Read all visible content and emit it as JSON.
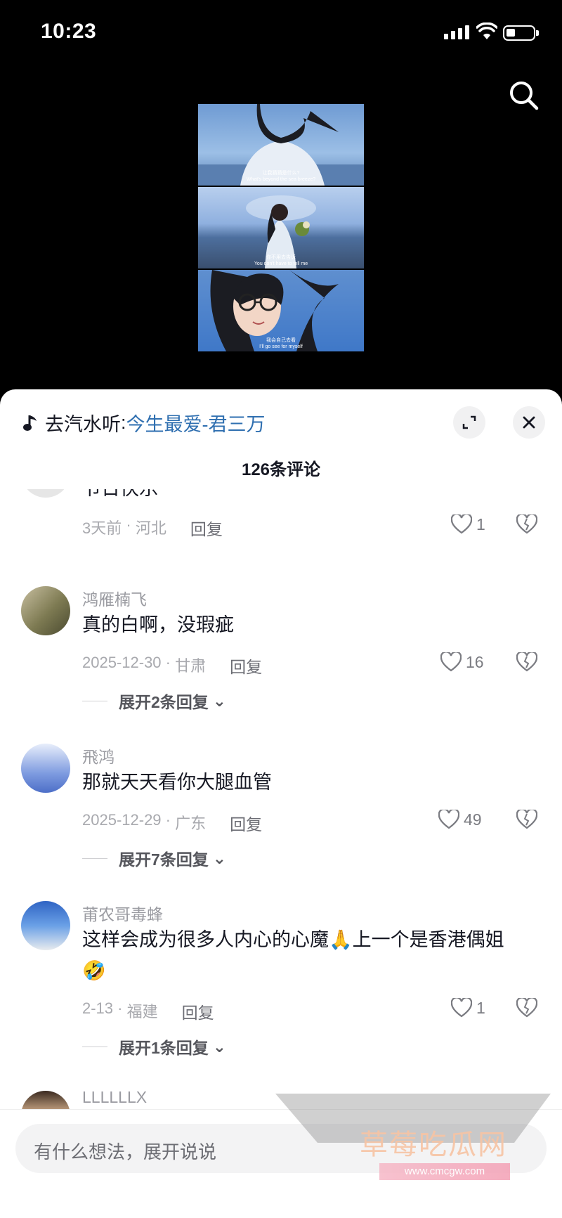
{
  "status": {
    "time": "10:23"
  },
  "music": {
    "prefix": "去汽水听",
    "separator": ":",
    "song": "今生最爱-君三万"
  },
  "comment_count": "126条评论",
  "video": {
    "subtitles": [
      {
        "cn": "让我猜猜是什么?",
        "en": "What's beyond the sea breeze?"
      },
      {
        "cn": "你不用去告诉",
        "en": "You don't have to tell me"
      },
      {
        "cn": "我会自己去看",
        "en": "I'll go see for myself"
      }
    ]
  },
  "comments": [
    {
      "name": "",
      "text": "节日快乐",
      "date": "3天前",
      "location": "河北",
      "reply": "回复",
      "likes": "1",
      "expand": ""
    },
    {
      "name": "鸿雁楠飞",
      "text": "真的白啊，没瑕疵",
      "date": "2025-12-30",
      "location": "甘肃",
      "reply": "回复",
      "likes": "16",
      "expand": "展开2条回复"
    },
    {
      "name": "飛鸿",
      "text": "那就天天看你大腿血管",
      "date": "2025-12-29",
      "location": "广东",
      "reply": "回复",
      "likes": "49",
      "expand": "展开7条回复"
    },
    {
      "name": "莆农哥毒蜂",
      "text": "这样会成为很多人内心的心魔🙏上一个是香港偶姐",
      "text2": "🤣",
      "date": "2-13",
      "location": "福建",
      "reply": "回复",
      "likes": "1",
      "expand": "展开1条回复"
    },
    {
      "name": "LLLLLLX",
      "text": ""
    }
  ],
  "input": {
    "placeholder": "有什么想法，展开说说"
  },
  "watermark": {
    "text": "草莓吃瓜网",
    "url": "www.cmcgw.com"
  },
  "colors": {
    "song_link": "#2f6fb0",
    "sheet_bg": "#ffffff",
    "meta": "#a8a9ae"
  }
}
